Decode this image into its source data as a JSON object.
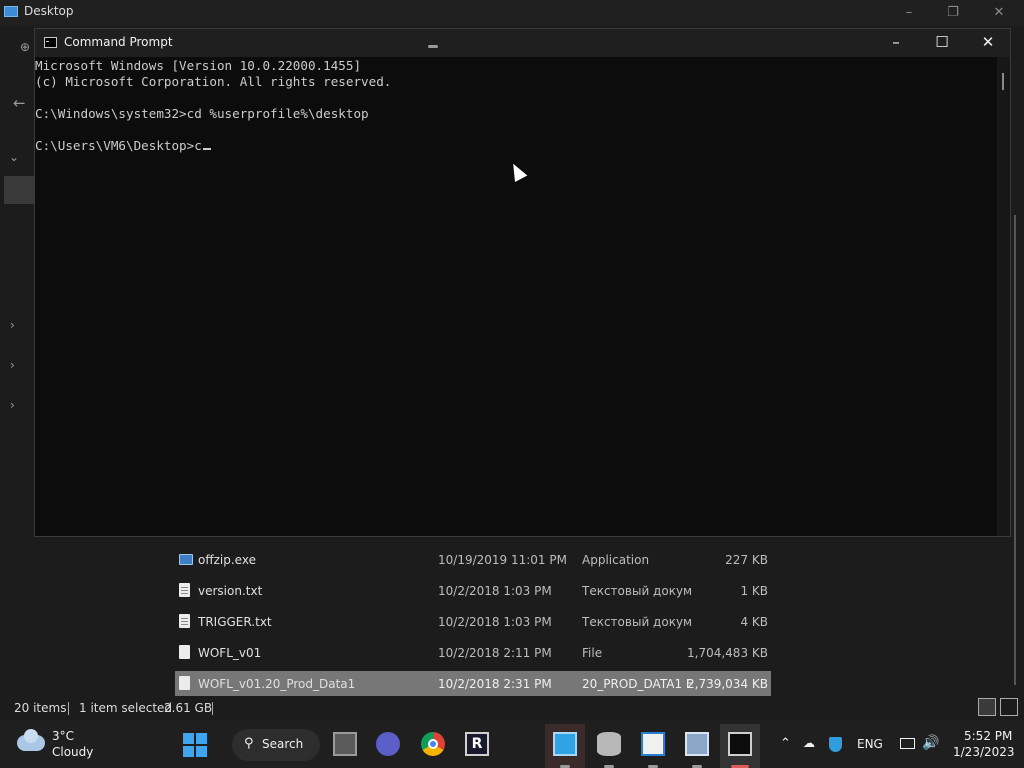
{
  "explorer": {
    "title": "Desktop",
    "files": [
      {
        "name": "offzip.exe",
        "date": "10/19/2019 11:01 PM",
        "type": "Application",
        "size": "227 KB",
        "icon": "exe-icon",
        "selected": false
      },
      {
        "name": "version.txt",
        "date": "10/2/2018 1:03 PM",
        "type": "Текстовый докум...",
        "size": "1 KB",
        "icon": "text-file-icon",
        "selected": false
      },
      {
        "name": "TRIGGER.txt",
        "date": "10/2/2018 1:03 PM",
        "type": "Текстовый докум...",
        "size": "4 KB",
        "icon": "text-file-icon",
        "selected": false
      },
      {
        "name": "WOFL_v01",
        "date": "10/2/2018 2:11 PM",
        "type": "File",
        "size": "1,704,483 KB",
        "icon": "file-icon",
        "selected": false
      },
      {
        "name": "WOFL_v01.20_Prod_Data1",
        "date": "10/2/2018 2:31 PM",
        "type": "20_PROD_DATA1 F...",
        "size": "2,739,034 KB",
        "icon": "file-icon",
        "selected": true
      }
    ],
    "status": {
      "item_count": "20 items",
      "selection": "1 item selected",
      "selection_size": "2.61 GB"
    }
  },
  "cmd": {
    "title": "Command Prompt",
    "lines": [
      "Microsoft Windows [Version 10.0.22000.1455]",
      "(c) Microsoft Corporation. All rights reserved.",
      "",
      "C:\\Windows\\system32>cd %userprofile%\\desktop",
      "",
      "C:\\Users\\VM6\\Desktop>c"
    ]
  },
  "taskbar": {
    "weather": {
      "temp": "3°C",
      "condition": "Cloudy"
    },
    "search_label": "Search",
    "apps": [
      "task-view-icon",
      "meet-icon",
      "chrome-icon",
      "r-app-icon",
      "remote-desktop-icon",
      "database-icon",
      "document-icon",
      "settings-tool-icon",
      "command-prompt-icon"
    ],
    "tray": {
      "language": "ENG",
      "time": "5:52 PM",
      "date": "1/23/2023"
    },
    "colors": {
      "accent": "#3fa5f0",
      "chrome_red": "#db4437",
      "active_indicator": "#e05a5a"
    }
  }
}
